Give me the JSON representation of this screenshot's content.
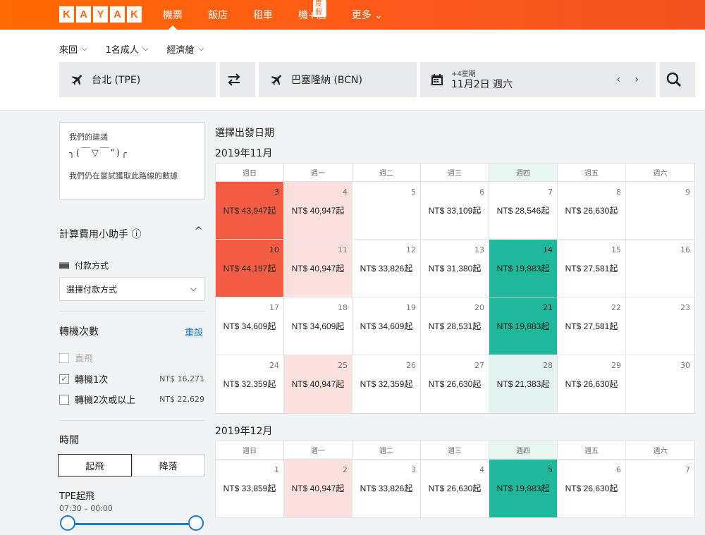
{
  "logo": [
    "K",
    "A",
    "Y",
    "A",
    "K"
  ],
  "nav": {
    "items": [
      {
        "label": "機票",
        "active": true
      },
      {
        "label": "飯店"
      },
      {
        "label": "租車"
      },
      {
        "label": "機+酒",
        "badge": "度假"
      },
      {
        "label": "更多 ⌄"
      }
    ]
  },
  "search": {
    "trip_type": "來回",
    "passengers": "1名成人",
    "cabin": "經濟艙",
    "from": "台北 (TPE)",
    "to": "巴塞隆納 (BCN)",
    "date_sub": "+4星期",
    "date": "11月2日 週六",
    "date_arrows": "‹ ›"
  },
  "sidebar": {
    "recommend_title": "我們的建議",
    "recommend_face": "╮(￣▽￣\")╭",
    "recommend_text": "我們仍在嘗試獲取此路線的數據",
    "fee_helper": "計算費用小助手 ⓘ",
    "fee_toggle": "^",
    "payment_label": "付款方式",
    "payment_select": "選擇付款方式",
    "stops_title": "轉機次數",
    "reset": "重設",
    "stops": [
      {
        "label": "直飛",
        "checked": false,
        "disabled": true,
        "price": ""
      },
      {
        "label": "轉機1次",
        "checked": true,
        "disabled": false,
        "price": "NT$ 16,271"
      },
      {
        "label": "轉機2次或以上",
        "checked": false,
        "disabled": false,
        "price": "NT$ 22,629"
      }
    ],
    "time_title": "時間",
    "time_tabs": [
      "起飛",
      "降落"
    ],
    "tpe_label": "TPE起飛",
    "time_range": "07:30 – 00:00"
  },
  "calendar": {
    "title": "選擇出發日期",
    "weekdays": [
      "週日",
      "週一",
      "週二",
      "週三",
      "週四",
      "週五",
      "週六"
    ],
    "months": [
      {
        "label": "2019年11月",
        "weeks": [
          [
            {
              "day": "3",
              "price": "NT$ 43,947起",
              "tone": "red"
            },
            {
              "day": "4",
              "price": "NT$ 40,947起",
              "tone": "pink"
            },
            {
              "day": "5",
              "price": ""
            },
            {
              "day": "6",
              "price": "NT$ 33,109起"
            },
            {
              "day": "7",
              "price": "NT$ 28,546起"
            },
            {
              "day": "8",
              "price": "NT$ 26,630起"
            },
            {
              "day": "9",
              "price": ""
            }
          ],
          [
            {
              "day": "10",
              "price": "NT$ 44,197起",
              "tone": "red"
            },
            {
              "day": "11",
              "price": "NT$ 40,947起",
              "tone": "pink"
            },
            {
              "day": "12",
              "price": "NT$ 33,826起"
            },
            {
              "day": "13",
              "price": "NT$ 31,380起"
            },
            {
              "day": "14",
              "price": "NT$ 19,883起",
              "tone": "green"
            },
            {
              "day": "15",
              "price": "NT$ 27,581起"
            },
            {
              "day": "16",
              "price": ""
            }
          ],
          [
            {
              "day": "17",
              "price": "NT$ 34,609起"
            },
            {
              "day": "18",
              "price": "NT$ 34,609起"
            },
            {
              "day": "19",
              "price": "NT$ 34,609起"
            },
            {
              "day": "20",
              "price": "NT$ 28,531起"
            },
            {
              "day": "21",
              "price": "NT$ 19,883起",
              "tone": "green"
            },
            {
              "day": "22",
              "price": "NT$ 27,581起"
            },
            {
              "day": "23",
              "price": ""
            }
          ],
          [
            {
              "day": "24",
              "price": "NT$ 32,359起"
            },
            {
              "day": "25",
              "price": "NT$ 40,947起",
              "tone": "pink"
            },
            {
              "day": "26",
              "price": "NT$ 32,359起"
            },
            {
              "day": "27",
              "price": "NT$ 26,630起"
            },
            {
              "day": "28",
              "price": "NT$ 21,383起",
              "tone": "lightgreen"
            },
            {
              "day": "29",
              "price": "NT$ 26,630起"
            },
            {
              "day": "30",
              "price": ""
            }
          ]
        ]
      },
      {
        "label": "2019年12月",
        "weeks": [
          [
            {
              "day": "1",
              "price": "NT$ 33,859起"
            },
            {
              "day": "2",
              "price": "NT$ 40,947起",
              "tone": "pink"
            },
            {
              "day": "3",
              "price": "NT$ 33,826起"
            },
            {
              "day": "4",
              "price": "NT$ 26,630起"
            },
            {
              "day": "5",
              "price": "NT$ 19,883起",
              "tone": "green"
            },
            {
              "day": "6",
              "price": "NT$ 26,630起"
            },
            {
              "day": "7",
              "price": ""
            }
          ]
        ]
      }
    ]
  },
  "colors": {
    "brand": "#ff690f",
    "link": "#1c7ad1",
    "cheap": "#1fb89a",
    "expensive": "#f25c42",
    "pricey": "#fbe1de"
  }
}
